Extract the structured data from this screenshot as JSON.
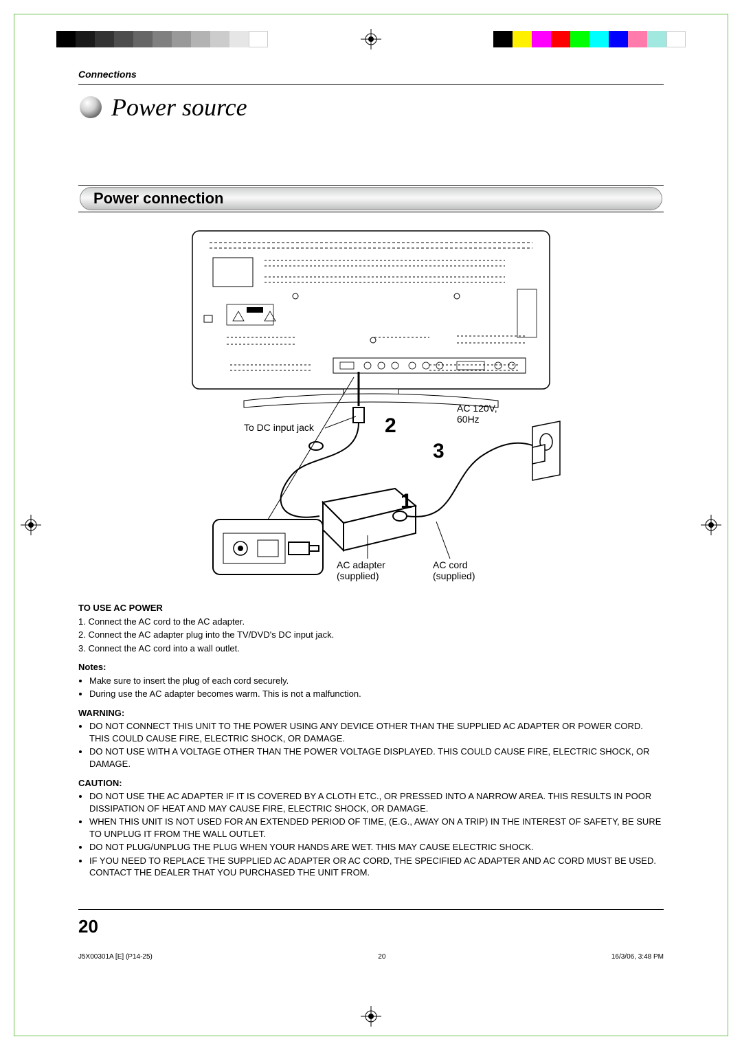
{
  "header": {
    "section_label": "Connections",
    "page_title": "Power source"
  },
  "section": {
    "heading": "Power connection"
  },
  "diagram": {
    "labels": {
      "dc_input": "To DC input jack",
      "ac_spec_line1": "AC 120V,",
      "ac_spec_line2": "60Hz",
      "ac_adapter_line1": "AC adapter",
      "ac_adapter_line2": "(supplied)",
      "ac_cord_line1": "AC cord",
      "ac_cord_line2": "(supplied)"
    },
    "callouts": {
      "one": "1",
      "two": "2",
      "three": "3"
    }
  },
  "instructions": {
    "to_use_heading": "TO USE AC POWER",
    "steps": [
      "1. Connect the AC cord to the AC adapter.",
      "2. Connect the AC adapter plug into the TV/DVD's DC input jack.",
      "3. Connect the AC cord into a wall outlet."
    ],
    "notes_heading": "Notes:",
    "notes": [
      "Make sure to insert the plug of each cord securely.",
      "During use the AC adapter becomes warm. This is not a malfunction."
    ],
    "warning_heading": "WARNING:",
    "warnings": [
      "DO NOT CONNECT THIS UNIT TO THE POWER USING ANY DEVICE OTHER THAN THE SUPPLIED AC ADAPTER OR POWER CORD. THIS COULD CAUSE FIRE, ELECTRIC SHOCK, OR DAMAGE.",
      "DO NOT USE WITH A VOLTAGE OTHER THAN THE POWER VOLTAGE DISPLAYED. THIS COULD CAUSE FIRE, ELECTRIC SHOCK, OR DAMAGE."
    ],
    "caution_heading": "CAUTION:",
    "cautions": [
      "DO NOT USE THE AC ADAPTER IF IT IS COVERED BY A CLOTH ETC., OR PRESSED INTO A NARROW AREA. THIS RESULTS IN POOR DISSIPATION OF HEAT AND MAY CAUSE FIRE, ELECTRIC SHOCK, OR DAMAGE.",
      "WHEN THIS UNIT IS NOT USED FOR AN EXTENDED PERIOD OF TIME, (E.G., AWAY ON A TRIP) IN THE INTEREST OF SAFETY, BE SURE TO UNPLUG IT FROM THE WALL OUTLET.",
      "DO NOT PLUG/UNPLUG THE PLUG WHEN YOUR HANDS ARE WET. THIS MAY CAUSE ELECTRIC SHOCK.",
      "IF YOU NEED TO REPLACE THE SUPPLIED AC ADAPTER OR AC CORD, THE SPECIFIED AC ADAPTER AND AC CORD MUST BE USED. CONTACT THE DEALER THAT YOU PURCHASED THE UNIT FROM."
    ]
  },
  "footer": {
    "page_number": "20",
    "doc_code": "J5X00301A [E] (P14-25)",
    "center_num": "20",
    "timestamp": "16/3/06, 3:48 PM"
  }
}
